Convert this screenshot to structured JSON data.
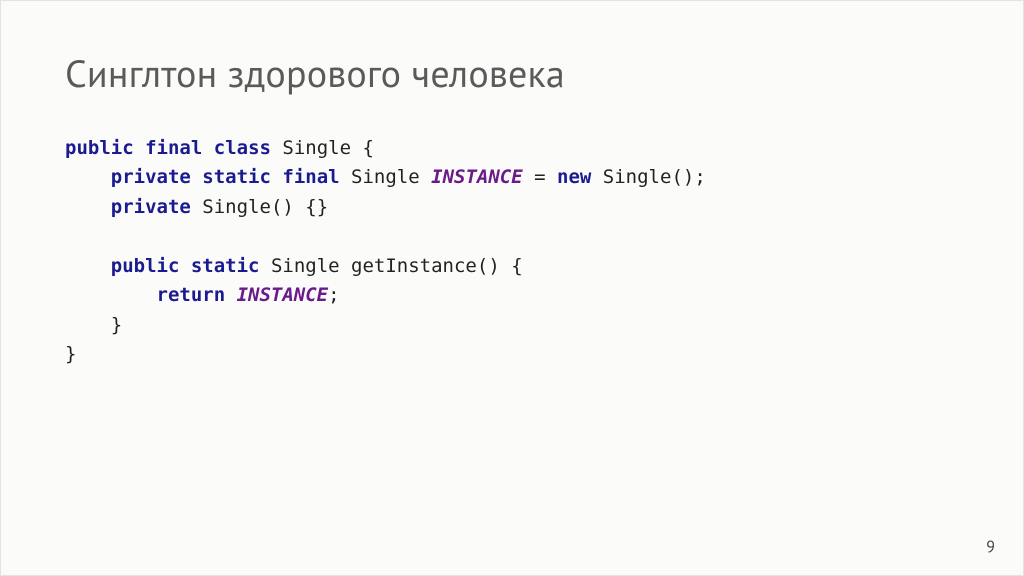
{
  "slide": {
    "title": "Синглтон здорового человека",
    "page_number": "9"
  },
  "code": {
    "kw_public": "public",
    "kw_final": "final",
    "kw_class": "class",
    "kw_private": "private",
    "kw_static": "static",
    "kw_new": "new",
    "kw_return": "return",
    "id_Single": "Single",
    "id_getInstance": "getInstance",
    "cst_INSTANCE": "INSTANCE",
    "sym_obrace": "{",
    "sym_cbrace": "}",
    "sym_eq": "=",
    "sym_semi": ";",
    "sym_parens_empty": "()",
    "sym_braces_empty": "{}",
    "indent1": "    ",
    "indent2": "        ",
    "sp": " "
  }
}
